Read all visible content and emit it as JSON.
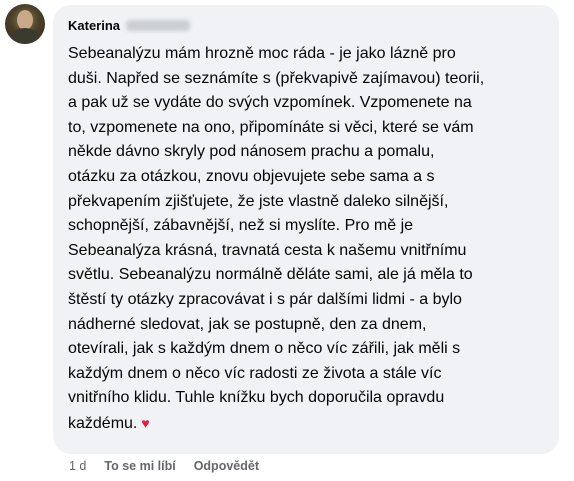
{
  "comment": {
    "author": "Katerina",
    "text_lines": [
      "Sebeanalýzu mám hrozně moc ráda - je jako lázně pro",
      "duši. Napřed se seznámíte s (překvapivě zajímavou) teorii,",
      "a pak už se vydáte do svých vzpomínek. Vzpomenete na",
      "to, vzpomenete na ono, připomínáte si věci, které se vám",
      "někde dávno skryly pod nánosem prachu a pomalu,",
      "otázku za otázkou, znovu objevujete sebe sama a s",
      "překvapením zjišťujete, že jste vlastně daleko silnější,",
      "schopnější, zábavnější, než si myslíte. Pro mě je",
      "Sebeanalýza krásná, travnatá cesta k našemu vnitřnímu",
      "světlu. Sebeanalýzu normálně děláte sami, ale já měla to",
      "štěstí ty otázky zpracovávat i s pár dalšími lidmi - a bylo",
      "nádherné sledovat, jak se postupně, den za dnem,",
      "otevírali, jak s každým dnem o něco víc zářili, jak měli s",
      "každým dnem o něco víc radosti ze života a stále víc",
      "vnitřního klidu. Tuhle knížku bych doporučila opravdu",
      "každému."
    ],
    "heart_glyph": "♥",
    "heart_color": "#e41e3f"
  },
  "actions": {
    "time": "1 d",
    "like_label": "To se mi líbí",
    "reply_label": "Odpovědět"
  }
}
